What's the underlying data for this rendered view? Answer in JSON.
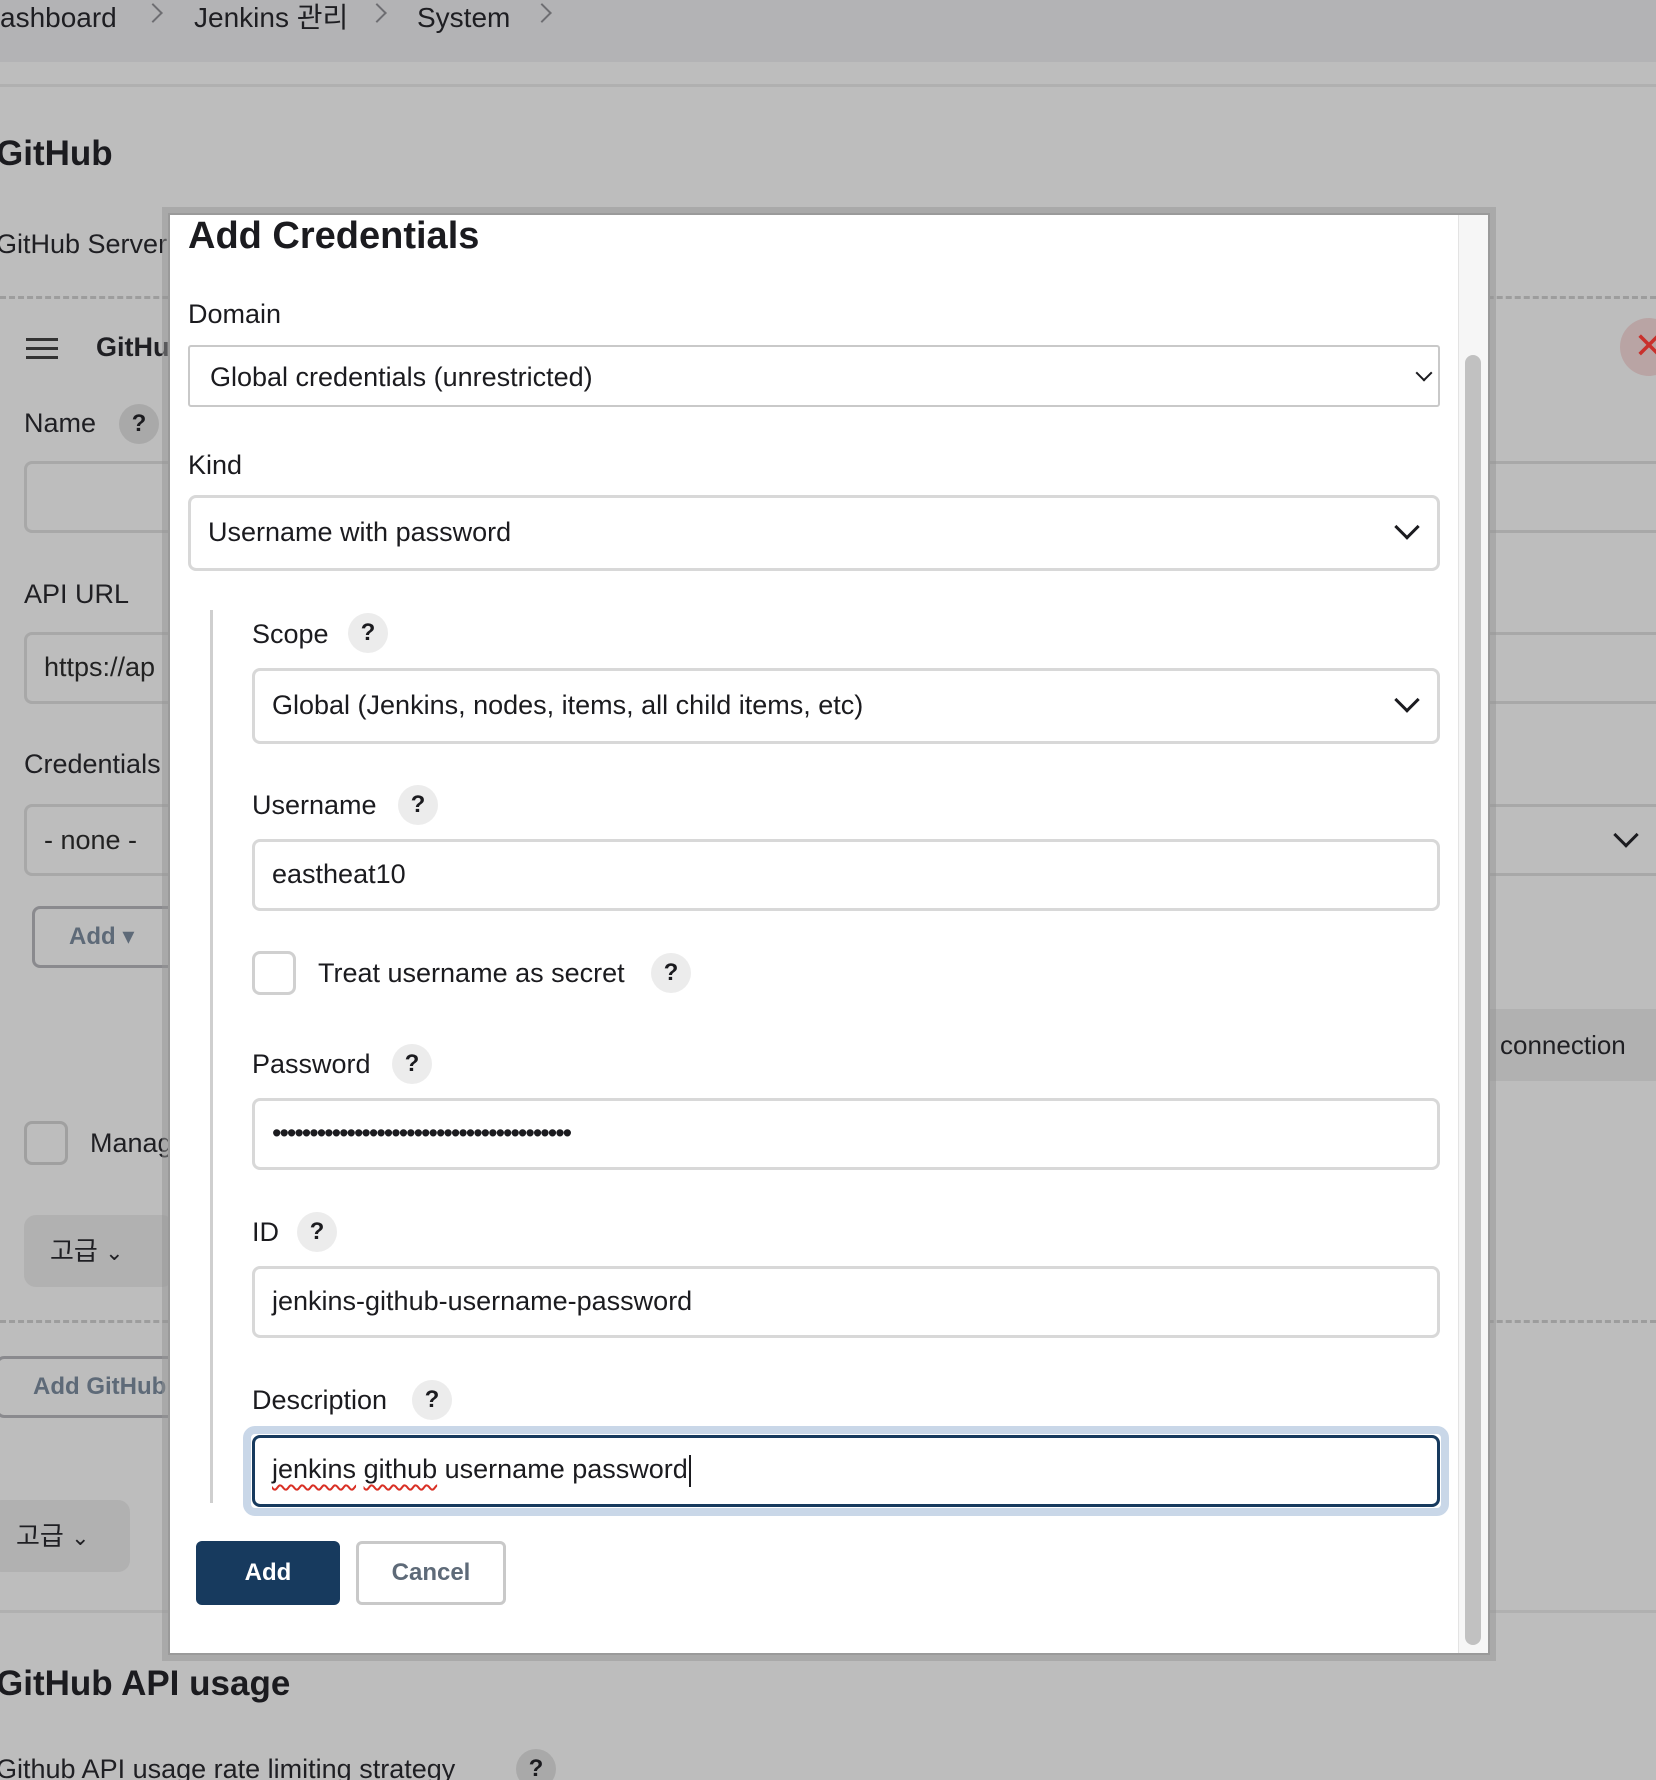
{
  "breadcrumb": {
    "items": [
      "ashboard",
      "Jenkins 관리",
      "System"
    ]
  },
  "background": {
    "section_title": "GitHub",
    "github_servers_label": "GitHub Server",
    "server_block_title": "GitHu",
    "name_label": "Name",
    "api_url_label": "API URL",
    "api_url_value": "https://ap",
    "credentials_label": "Credentials",
    "credentials_value": "- none -",
    "add_button_label": "Add",
    "test_connection_label": "connection",
    "manage_hooks_label": "Manag",
    "advanced_label": "고급",
    "add_github_server_label": "Add GitHub",
    "advanced_label_2": "고급",
    "api_usage_title": "GitHub API usage",
    "rate_limit_label": "Github API usage rate limiting strategy"
  },
  "modal": {
    "title": "Add Credentials",
    "domain_label": "Domain",
    "domain_value": "Global credentials (unrestricted)",
    "kind_label": "Kind",
    "kind_value": "Username with password",
    "scope_label": "Scope",
    "scope_value": "Global (Jenkins, nodes, items, all child items, etc)",
    "username_label": "Username",
    "username_value": "eastheat10",
    "treat_secret_label": "Treat username as secret",
    "treat_secret_checked": false,
    "password_label": "Password",
    "password_value": "••••••••••••••••••••••••••••••••••••••••",
    "id_label": "ID",
    "id_value": "jenkins-github-username-password",
    "description_label": "Description",
    "description_value": {
      "word1": "jenkins",
      "word2": "github",
      "rest": " username password"
    },
    "add_button": "Add",
    "cancel_button": "Cancel",
    "help_glyph": "?"
  },
  "colors": {
    "primary": "#173a5e",
    "overlay": "#bdbdbd",
    "close": "#c9302c"
  },
  "icons": {
    "close": "✕"
  }
}
